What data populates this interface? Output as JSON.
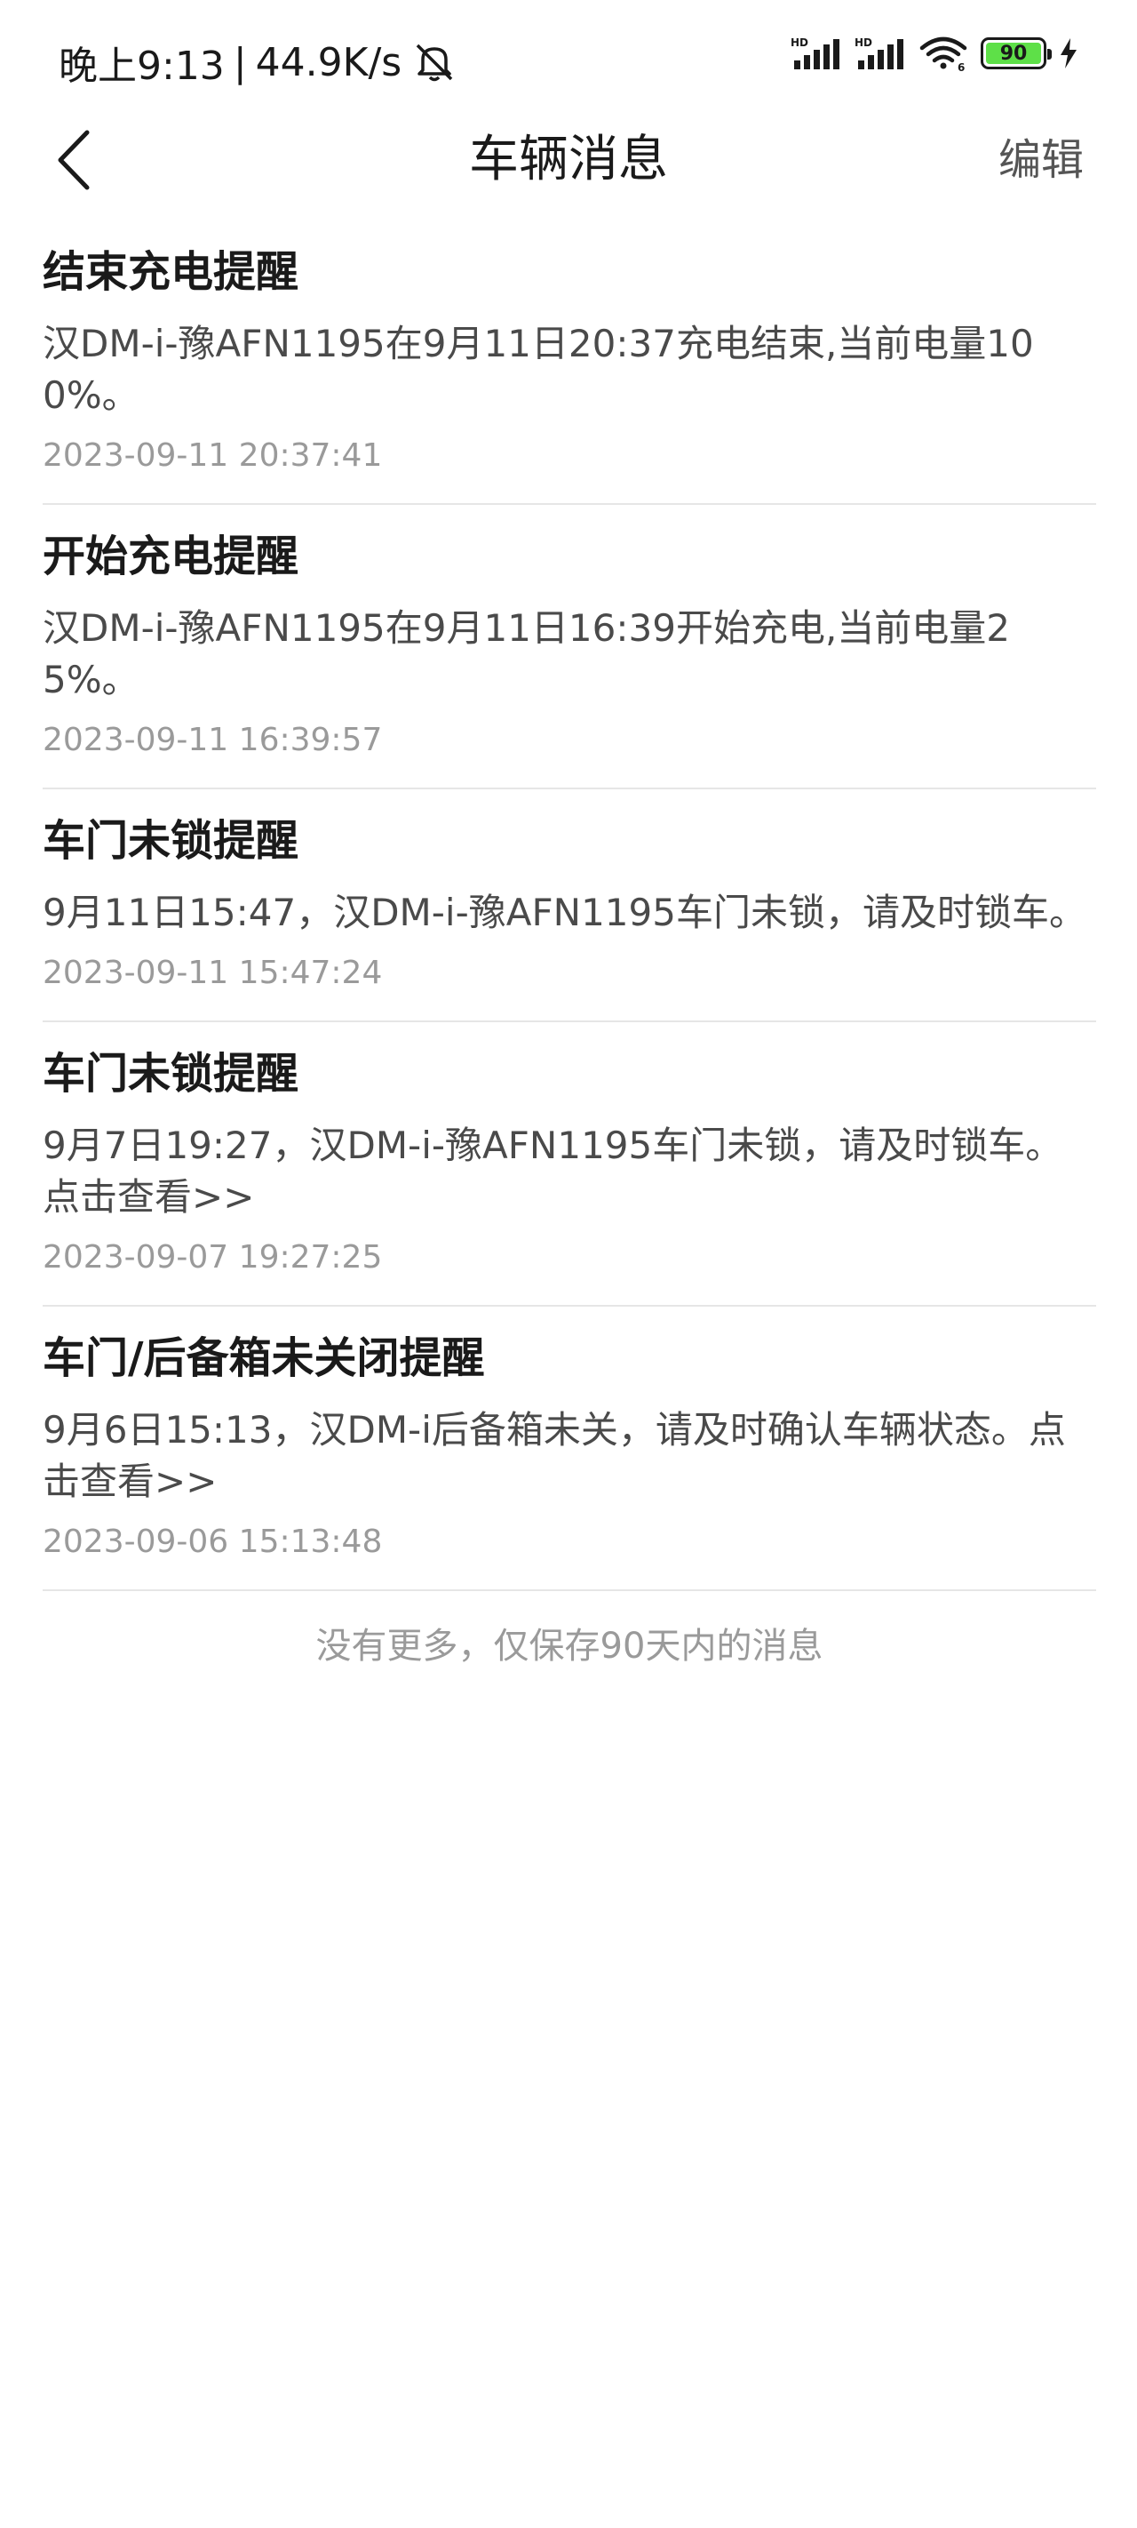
{
  "status_bar": {
    "time": "晚上9:13",
    "separator": "|",
    "net_speed": "44.9K/s",
    "icons": [
      "mute-icon",
      "hd-signal-icon",
      "hd-signal-icon",
      "wifi-icon",
      "battery-icon",
      "charging-icon"
    ],
    "hd_label": "HD",
    "wifi_label": "6",
    "battery_level": "90",
    "battery_color": "#5ee048"
  },
  "nav": {
    "title": "车辆消息",
    "edit_label": "编辑",
    "back_icon": "chevron-left-icon"
  },
  "messages": [
    {
      "title": "结束充电提醒",
      "body": "汉DM-i-豫AFN1195在9月11日20:37充电结束,当前电量100%。",
      "time": "2023-09-11 20:37:41"
    },
    {
      "title": "开始充电提醒",
      "body": "汉DM-i-豫AFN1195在9月11日16:39开始充电,当前电量25%。",
      "time": "2023-09-11 16:39:57"
    },
    {
      "title": "车门未锁提醒",
      "body": "9月11日15:47，汉DM-i-豫AFN1195车门未锁，请及时锁车。",
      "time": "2023-09-11 15:47:24"
    },
    {
      "title": "车门未锁提醒",
      "body": "9月7日19:27，汉DM-i-豫AFN1195车门未锁，请及时锁车。点击查看>>",
      "time": "2023-09-07 19:27:25"
    },
    {
      "title": "车门/后备箱未关闭提醒",
      "body": "9月6日15:13，汉DM-i后备箱未关，请及时确认车辆状态。点击查看>>",
      "time": "2023-09-06 15:13:48"
    }
  ],
  "footer": {
    "note": "没有更多，仅保存90天内的消息"
  }
}
